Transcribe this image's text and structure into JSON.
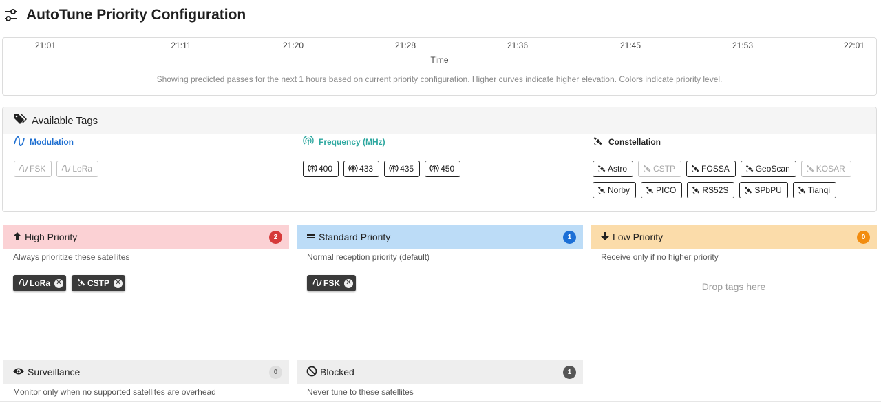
{
  "page": {
    "title": "AutoTune Priority Configuration"
  },
  "timeline": {
    "ticks": [
      "21:01",
      "21:11",
      "21:20",
      "21:28",
      "21:36",
      "21:45",
      "21:53",
      "22:01"
    ],
    "axis_label": "Time",
    "caption": "Showing predicted passes for the next 1 hours based on current priority configuration. Higher curves indicate higher elevation. Colors indicate priority level."
  },
  "tags": {
    "title": "Available Tags",
    "modulation": {
      "title": "Modulation",
      "color": "#1e6fd1",
      "items": [
        "FSK",
        "LoRa"
      ]
    },
    "frequency": {
      "title": "Frequency (MHz)",
      "color": "#2ea8a0",
      "items": [
        "400",
        "433",
        "435",
        "450"
      ]
    },
    "constellation": {
      "title": "Constellation",
      "items": [
        "Astro",
        "CSTP",
        "FOSSA",
        "GeoScan",
        "KOSAR",
        "Norby",
        "PICO",
        "RS52S",
        "SPbPU",
        "Tianqi"
      ]
    }
  },
  "priorities": {
    "high": {
      "label": "High Priority",
      "count": "2",
      "desc": "Always prioritize these satellites",
      "bg": "#fbd1d4",
      "badge": "#d63a3a",
      "chips": [
        "LoRa",
        "CSTP"
      ]
    },
    "standard": {
      "label": "Standard Priority",
      "count": "1",
      "desc": "Normal reception priority (default)",
      "bg": "#bcdcf7",
      "badge": "#1c6fd6",
      "chips": [
        "FSK"
      ]
    },
    "low": {
      "label": "Low Priority",
      "count": "0",
      "desc": "Receive only if no higher priority",
      "bg": "#fbdcaa",
      "badge": "#f28c0f",
      "drop_hint": "Drop tags here"
    },
    "surveillance": {
      "label": "Surveillance",
      "count": "0",
      "desc": "Monitor only when no supported satellites are overhead",
      "bg": "#eeeeee",
      "badge": "#dedede"
    },
    "blocked": {
      "label": "Blocked",
      "count": "1",
      "desc": "Never tune to these satellites",
      "bg": "#eeeeee",
      "badge": "#555555"
    }
  }
}
